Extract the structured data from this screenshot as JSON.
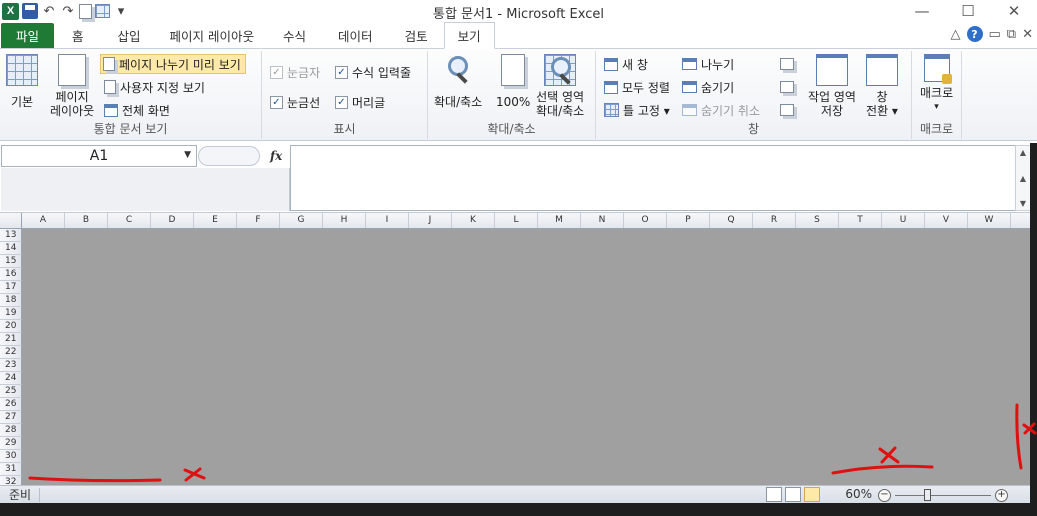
{
  "window": {
    "title": "통합 문서1 - Microsoft Excel",
    "app_icon": "X",
    "controls": {
      "minimize": "—",
      "maximize": "☐",
      "close": "✕"
    }
  },
  "qat": {
    "undo": "↶",
    "redo": "↷",
    "customize": "▾"
  },
  "tabs": [
    {
      "label": "파일"
    },
    {
      "label": "홈"
    },
    {
      "label": "삽입"
    },
    {
      "label": "페이지 레이아웃"
    },
    {
      "label": "수식"
    },
    {
      "label": "데이터"
    },
    {
      "label": "검토"
    },
    {
      "label": "보기"
    }
  ],
  "tab_right": {
    "collapse": "△",
    "help": "?",
    "min": "▭",
    "restore": "⧉",
    "close": "✕"
  },
  "ribbon": {
    "workbook_views": {
      "label": "통합 문서 보기",
      "normal": "기본",
      "page_layout_line1": "페이지",
      "page_layout_line2": "레이아웃",
      "page_break": "페이지 나누기 미리 보기",
      "custom_views": "사용자 지정 보기",
      "full_screen": "전체 화면"
    },
    "show": {
      "label": "표시",
      "ruler": "눈금자",
      "formula_bar": "수식 입력줄",
      "gridlines": "눈금선",
      "headings": "머리글",
      "check": "✓"
    },
    "zoom": {
      "label": "확대/축소",
      "zoom": "확대/축소",
      "hundred": "100%",
      "sel_line1": "선택 영역",
      "sel_line2": "확대/축소"
    },
    "window": {
      "label": "창",
      "new_window": "새 창",
      "arrange_all": "모두 정렬",
      "freeze": "틀 고정 ▾",
      "split": "나누기",
      "hide": "숨기기",
      "unhide": "숨기기 취소",
      "save_ws_line1": "작업 영역",
      "save_ws_line2": "저장",
      "switch_line1": "창",
      "switch_line2": "전환 ▾"
    },
    "macros": {
      "label": "매크로",
      "macros": "매크로",
      "arrow": "▾"
    }
  },
  "formula_bar": {
    "name_box": "A1",
    "dropdown": "▼",
    "fx": "fx",
    "scroll_up": "▲",
    "scroll_mid": "▲",
    "scroll_down": "▼"
  },
  "sheet": {
    "columns": [
      "A",
      "B",
      "C",
      "D",
      "E",
      "F",
      "G",
      "H",
      "I",
      "J",
      "K",
      "L",
      "M",
      "N",
      "O",
      "P",
      "Q",
      "R",
      "S",
      "T",
      "U",
      "V",
      "W"
    ],
    "rows": [
      "13",
      "14",
      "15",
      "16",
      "17",
      "18",
      "19",
      "20",
      "21",
      "22",
      "23",
      "24",
      "25",
      "26",
      "27",
      "28",
      "29",
      "30",
      "31",
      "32"
    ]
  },
  "status": {
    "ready": "준비",
    "zoom": "60%",
    "zoom_out": "−",
    "zoom_in": "+",
    "zoom_fraction": 0.3
  },
  "annotation_color": "#e01010"
}
